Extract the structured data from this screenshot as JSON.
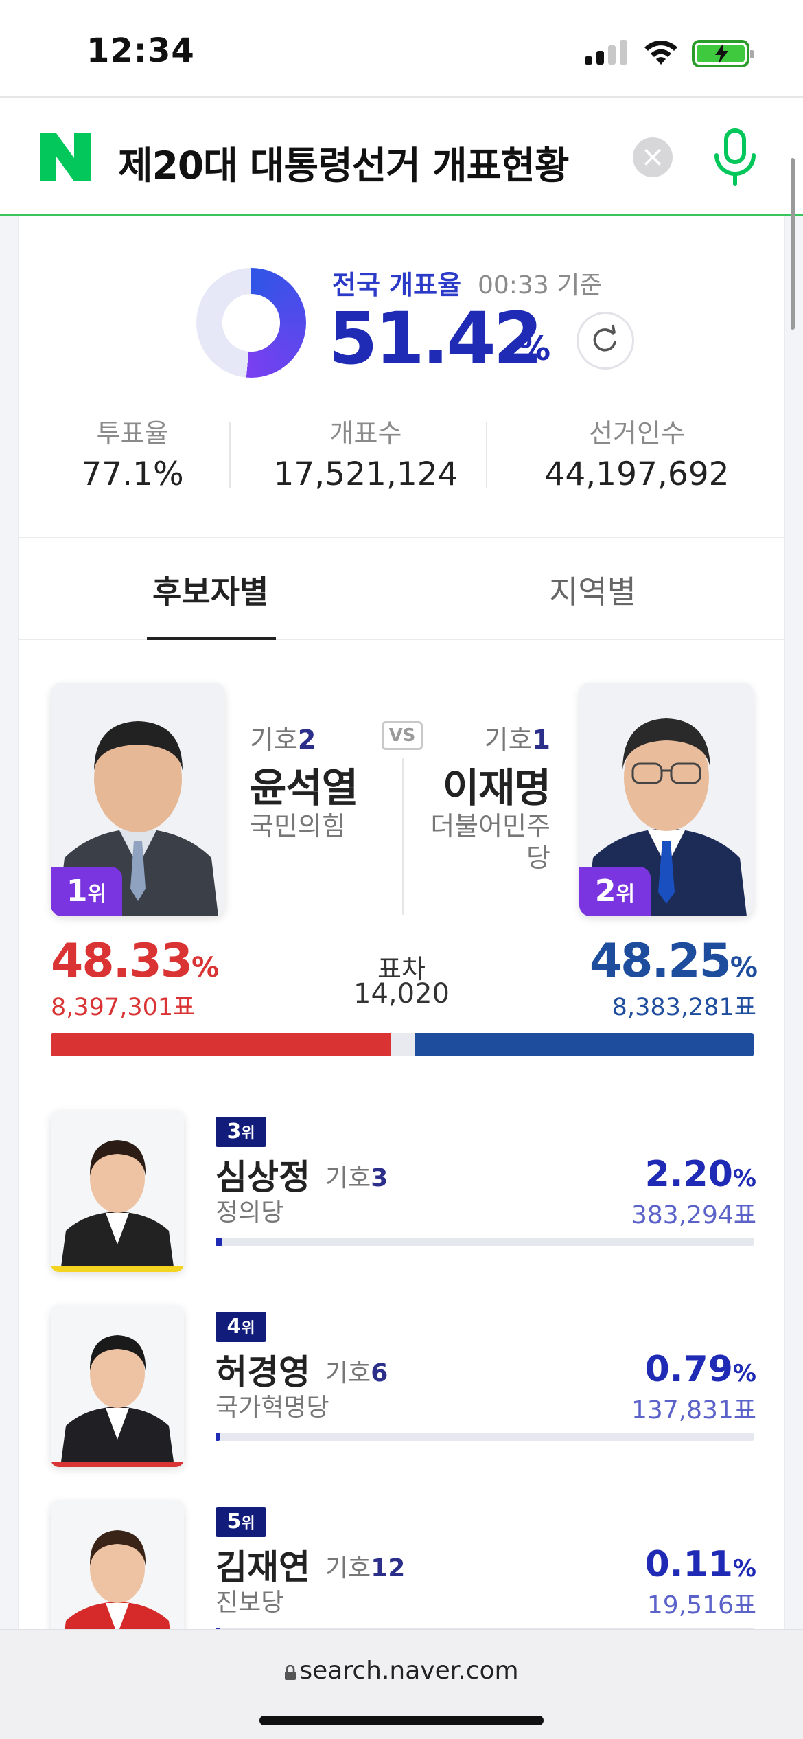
{
  "status": {
    "time": "12:34"
  },
  "search": {
    "query": "제20대 대통령선거 개표현황",
    "clear_icon": "×"
  },
  "summary": {
    "rate_label": "전국 개표율",
    "rate_time": "00:33 기준",
    "rate_value": "51.42",
    "rate_unit": "%",
    "progress": 51.42,
    "turnout_label": "투표율",
    "turnout_value": "77.1%",
    "counted_label": "개표수",
    "counted_value": "17,521,124",
    "voters_label": "선거인수",
    "voters_value": "44,197,692"
  },
  "tabs": {
    "by_candidate": "후보자별",
    "by_region": "지역별"
  },
  "top": {
    "vs": "VS",
    "diff_label": "표차",
    "diff_value": "14,020",
    "left": {
      "rank": "1",
      "rank_suffix": "위",
      "ballot_label": "기호",
      "ballot_no": "2",
      "name": "윤석열",
      "party": "국민의힘",
      "pct": "48.33",
      "unit": "%",
      "votes": "8,397,301표",
      "share": 48.33,
      "color": "#d93333"
    },
    "right": {
      "rank": "2",
      "rank_suffix": "위",
      "ballot_label": "기호",
      "ballot_no": "1",
      "name": "이재명",
      "party": "더불어민주당",
      "pct": "48.25",
      "unit": "%",
      "votes": "8,383,281표",
      "share": 48.25,
      "color": "#1e4d9e"
    }
  },
  "others": [
    {
      "rank": "3",
      "rank_suffix": "위",
      "name": "심상정",
      "ballot_label": "기호",
      "ballot_no": "3",
      "party": "정의당",
      "pct": "2.20",
      "unit": "%",
      "votes": "383,294표",
      "share": 2.2,
      "stripe": "#f4d321"
    },
    {
      "rank": "4",
      "rank_suffix": "위",
      "name": "허경영",
      "ballot_label": "기호",
      "ballot_no": "6",
      "party": "국가혁명당",
      "pct": "0.79",
      "unit": "%",
      "votes": "137,831표",
      "share": 0.79,
      "stripe": "#d93333"
    },
    {
      "rank": "5",
      "rank_suffix": "위",
      "name": "김재연",
      "ballot_label": "기호",
      "ballot_no": "12",
      "party": "진보당",
      "pct": "0.11",
      "unit": "%",
      "votes": "19,516표",
      "share": 0.11,
      "stripe": "#d93333"
    }
  ],
  "browser": {
    "url": "search.naver.com"
  },
  "colors": {
    "naver_green": "#03c75a",
    "accent_blue": "#1f2bb5",
    "purple": "#7a34e0"
  }
}
